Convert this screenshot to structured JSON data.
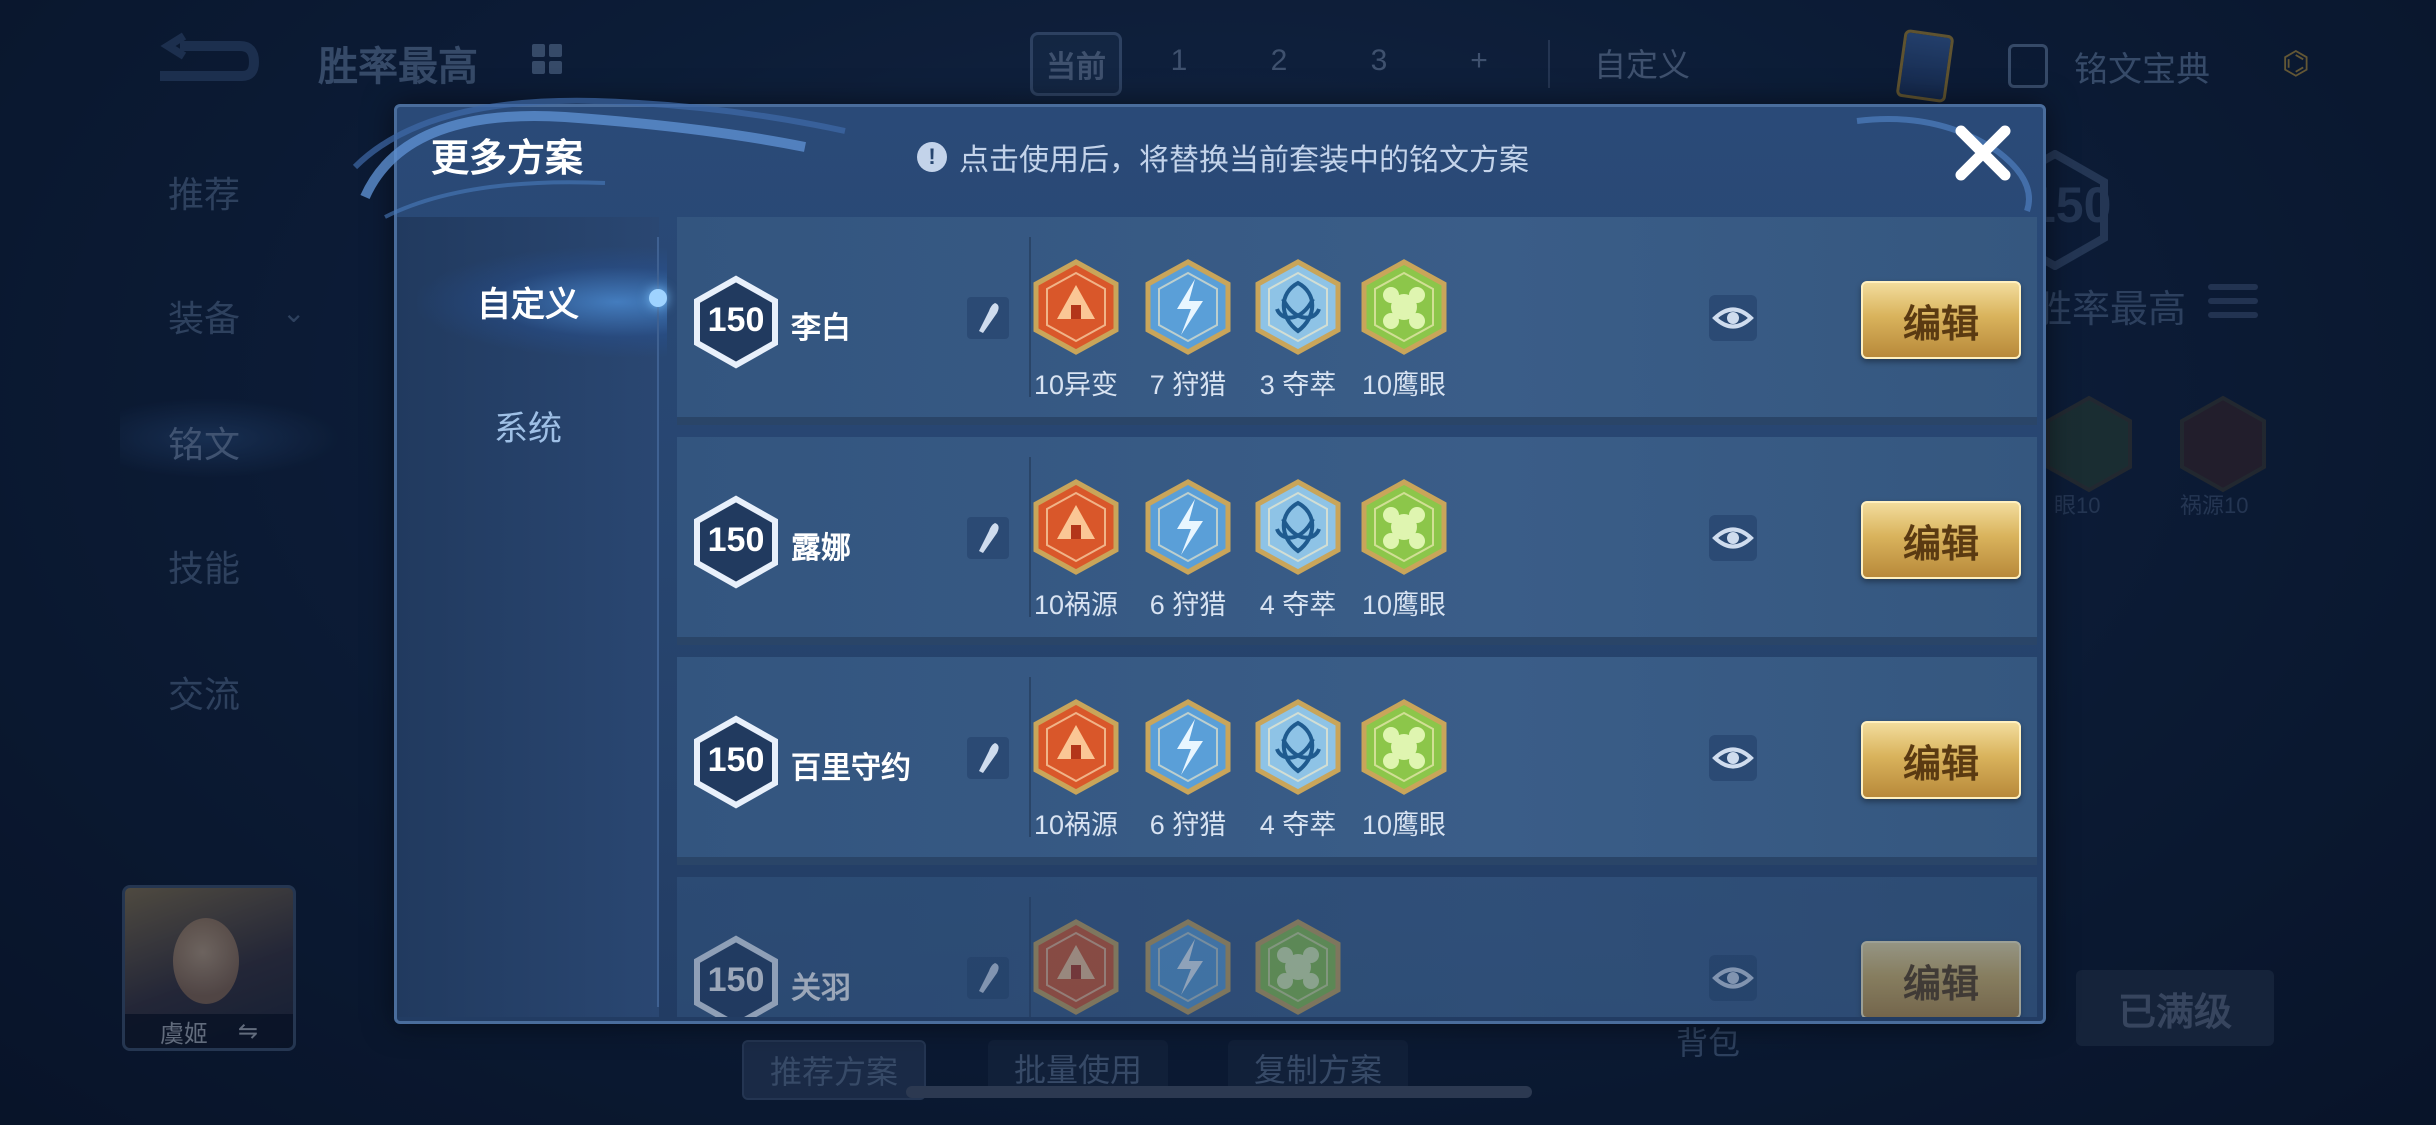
{
  "background": {
    "title": "胜率最高",
    "page_tabs": [
      "当前",
      "1",
      "2",
      "3",
      "+"
    ],
    "custom_tab": "自定义",
    "codex_label": "铭文宝典",
    "side_items": [
      "推荐",
      "装备",
      "铭文",
      "技能",
      "交流"
    ],
    "hero_name": "虞姬",
    "bottom_buttons": [
      "推荐方案",
      "批量使用",
      "复制方案"
    ],
    "backpack": "背包",
    "full_level": "已满级",
    "right_level": "150",
    "right_label": "胜率最高",
    "right_runes": [
      "眼10",
      "祸源10"
    ]
  },
  "modal": {
    "title": "更多方案",
    "notice": "点击使用后，将替换当前套装中的铭文方案",
    "tabs": [
      {
        "label": "自定义",
        "active": true
      },
      {
        "label": "系统",
        "active": false
      }
    ],
    "edit_label": "编辑",
    "rows": [
      {
        "level": "150",
        "hero": "李白",
        "runes": [
          {
            "icon": "red-rune-icon",
            "label": "10异变"
          },
          {
            "icon": "blue-rune-icon",
            "label": "7 狩猎"
          },
          {
            "icon": "blue-knot-rune-icon",
            "label": "3 夺萃"
          },
          {
            "icon": "green-rune-icon",
            "label": "10鹰眼"
          }
        ]
      },
      {
        "level": "150",
        "hero": "露娜",
        "runes": [
          {
            "icon": "red-rune-icon",
            "label": "10祸源"
          },
          {
            "icon": "blue-rune-icon",
            "label": "6 狩猎"
          },
          {
            "icon": "blue-knot-rune-icon",
            "label": "4 夺萃"
          },
          {
            "icon": "green-rune-icon",
            "label": "10鹰眼"
          }
        ]
      },
      {
        "level": "150",
        "hero": "百里守约",
        "runes": [
          {
            "icon": "red-rune-icon",
            "label": "10祸源"
          },
          {
            "icon": "blue-rune-icon",
            "label": "6 狩猎"
          },
          {
            "icon": "blue-knot-rune-icon",
            "label": "4 夺萃"
          },
          {
            "icon": "green-rune-icon",
            "label": "10鹰眼"
          }
        ]
      },
      {
        "level": "150",
        "hero": "关羽",
        "runes": [
          {
            "icon": "red-rune-icon",
            "label": ""
          },
          {
            "icon": "blue-rune-icon",
            "label": ""
          },
          {
            "icon": "green-rune-icon",
            "label": ""
          }
        ]
      }
    ]
  },
  "colors": {
    "red": "#d9572a",
    "blue": "#5a9fd8",
    "knot": "#8ec3e6",
    "green": "#8cc64a",
    "gold": "#d9b35c"
  }
}
